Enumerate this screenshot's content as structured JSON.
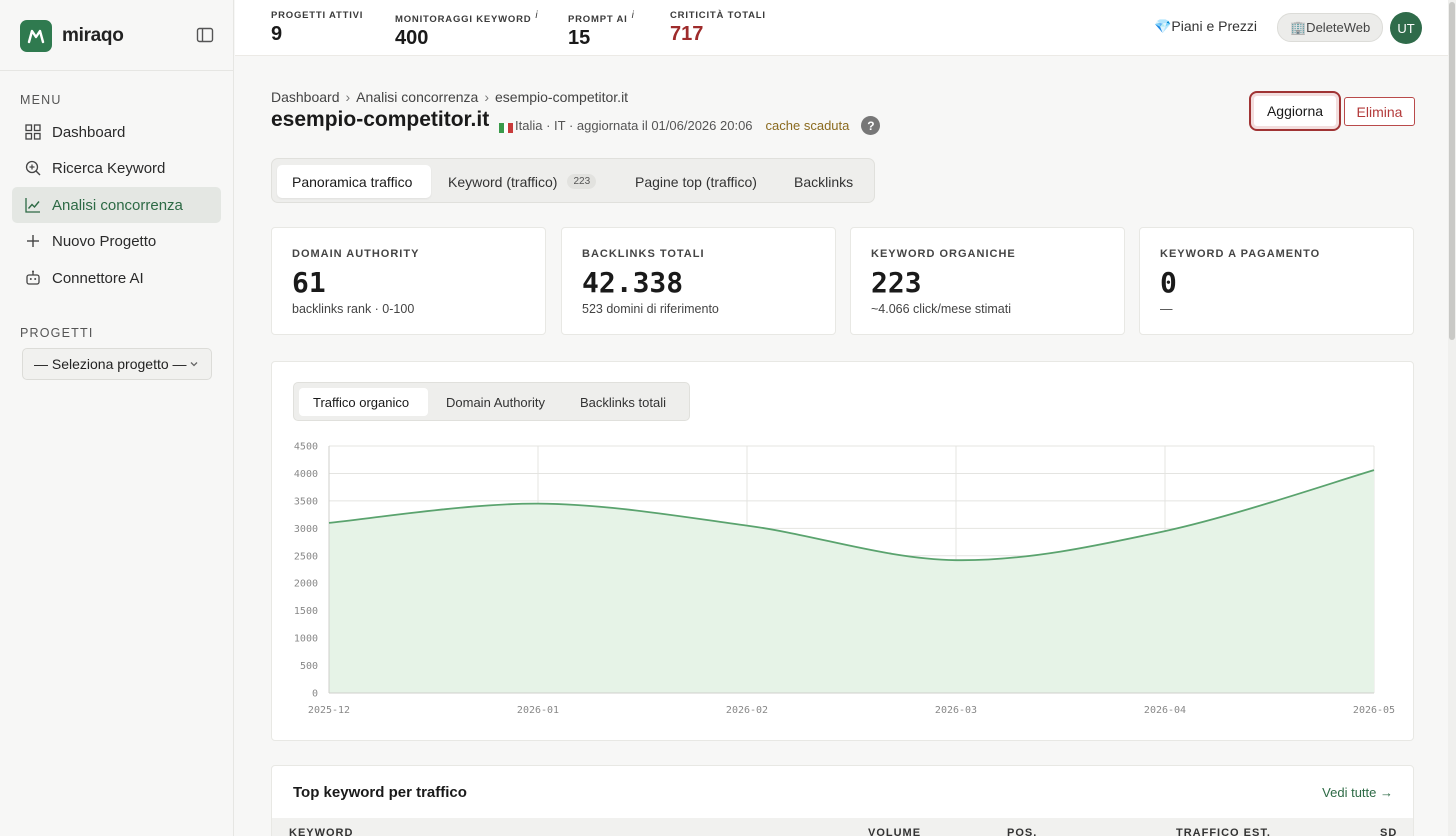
{
  "brand": {
    "name": "miraqo",
    "logo_color": "#2f7a4f"
  },
  "sidebar": {
    "menu_title": "MENU",
    "items": [
      {
        "label": "Dashboard",
        "icon": "grid-icon",
        "active": false
      },
      {
        "label": "Ricerca Keyword",
        "icon": "search-plus-icon",
        "active": false
      },
      {
        "label": "Analisi concorrenza",
        "icon": "line-chart-icon",
        "active": true
      },
      {
        "label": "Nuovo Progetto",
        "icon": "plus-icon",
        "active": false
      },
      {
        "label": "Connettore AI",
        "icon": "robot-icon",
        "active": false
      }
    ],
    "projects_title": "PROGETTI",
    "project_select": "— Seleziona progetto —"
  },
  "topbar": {
    "stats": [
      {
        "label": "PROGETTI ATTIVI",
        "value": "9",
        "info": ""
      },
      {
        "label": "MONITORAGGI KEYWORD",
        "value": "400",
        "info": "i"
      },
      {
        "label": "PROMPT AI",
        "value": "15",
        "info": "i"
      },
      {
        "label": "CRITICITÀ TOTALI",
        "value": "717",
        "info": ""
      }
    ],
    "plans_label": "💎Piani e Prezzi",
    "account_label": "🏢DeleteWeb",
    "avatar_initials": "UT"
  },
  "breadcrumb": [
    "Dashboard",
    "Analisi concorrenza",
    "esempio-competitor.it"
  ],
  "breadcrumb_sep": "›",
  "page": {
    "title": "esempio-competitor.it",
    "meta": "Italia · IT · aggiornata il 01/06/2026 20:06",
    "cache_status": "cache scaduta",
    "help": "?",
    "refresh_label": "Aggiorna",
    "delete_label": "Elimina"
  },
  "tabs": [
    {
      "label": "Panoramica traffico",
      "badge": "",
      "active": true
    },
    {
      "label": "Keyword (traffico)",
      "badge": "223",
      "active": false
    },
    {
      "label": "Pagine top (traffico)",
      "badge": "",
      "active": false
    },
    {
      "label": "Backlinks",
      "badge": "",
      "active": false
    }
  ],
  "kpis": [
    {
      "title": "DOMAIN AUTHORITY",
      "value": "61",
      "sub": "backlinks rank · 0-100"
    },
    {
      "title": "BACKLINKS TOTALI",
      "value": "42.338",
      "sub": "523 domini di riferimento"
    },
    {
      "title": "KEYWORD ORGANICHE",
      "value": "223",
      "sub": "~4.066 click/mese stimati"
    },
    {
      "title": "KEYWORD A PAGAMENTO",
      "value": "0",
      "sub": "—"
    }
  ],
  "chart_tabs": [
    {
      "label": "Traffico organico",
      "active": true
    },
    {
      "label": "Domain Authority",
      "active": false
    },
    {
      "label": "Backlinks totali",
      "active": false
    }
  ],
  "chart_data": {
    "type": "area",
    "x": [
      "2025-12",
      "2026-01",
      "2026-02",
      "2026-03",
      "2026-04",
      "2026-05"
    ],
    "series": [
      {
        "values": [
          3100,
          3450,
          3050,
          2420,
          2950,
          4060
        ]
      }
    ],
    "ylim": [
      0,
      4500
    ],
    "yticks": [
      0,
      500,
      1000,
      1500,
      2000,
      2500,
      3000,
      3500,
      4000,
      4500
    ],
    "grid": true,
    "line_color": "#5aa36e",
    "fill_color": "#e6f3e7"
  },
  "keywords": {
    "title": "Top keyword per traffico",
    "link": "Vedi tutte →",
    "columns": [
      "KEYWORD",
      "VOLUME",
      "POS.",
      "TRAFFICO EST.",
      "SD"
    ]
  }
}
